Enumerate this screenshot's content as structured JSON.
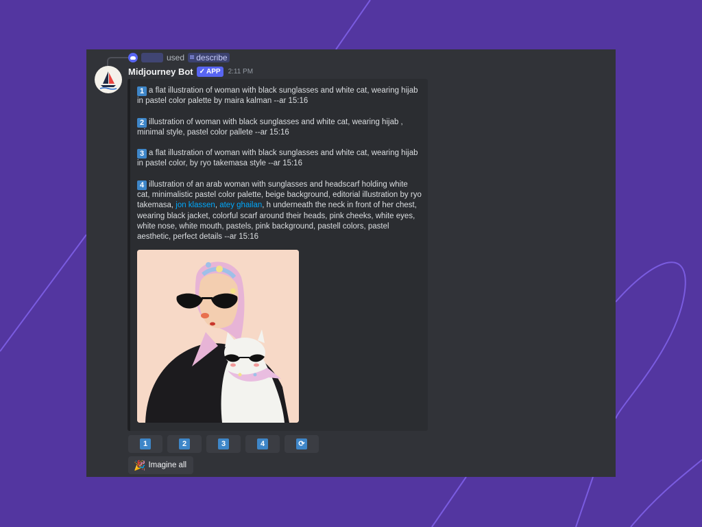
{
  "reply": {
    "used_text": "used",
    "command": "describe"
  },
  "message": {
    "username": "Midjourney Bot",
    "badge": "APP",
    "timestamp": "2:11 PM"
  },
  "prompts": [
    {
      "number": "1",
      "text": "a flat illustration of woman with black sunglasses and white cat, wearing hijab in pastel color palette by maira kalman --ar 15:16"
    },
    {
      "number": "2",
      "text": "illustration of woman with black sunglasses and white cat, wearing hijab , minimal style, pastel color pallete --ar 15:16"
    },
    {
      "number": "3",
      "text": "a flat illustration of woman with black sunglasses and white cat, wearing hijab in pastel color, by ryo takemasa style --ar 15:16"
    },
    {
      "number": "4",
      "text_before": "illustration of an arab woman with sunglasses and headscarf holding white cat, minimalistic pastel color palette, beige background, editorial illustration by ryo takemasa,",
      "link1": "jon klassen",
      "separator": ",",
      "link2": "atey ghailan",
      "text_after": ", h underneath the neck in front of her chest, wearing black jacket, colorful scarf around their heads, pink cheeks, white eyes, white nose, white mouth, pastels, pink background, pastell colors, pastel aesthetic, perfect details --ar 15:16"
    }
  ],
  "buttons": [
    {
      "label": "1"
    },
    {
      "label": "2"
    },
    {
      "label": "3"
    },
    {
      "label": "4"
    }
  ],
  "imagine_all": "Imagine all",
  "colors": {
    "background": "#5336a0",
    "window": "#313338",
    "embed": "#2b2d31",
    "accent": "#5865f2",
    "number_badge": "#3e86c8",
    "link": "#00a8fc"
  }
}
